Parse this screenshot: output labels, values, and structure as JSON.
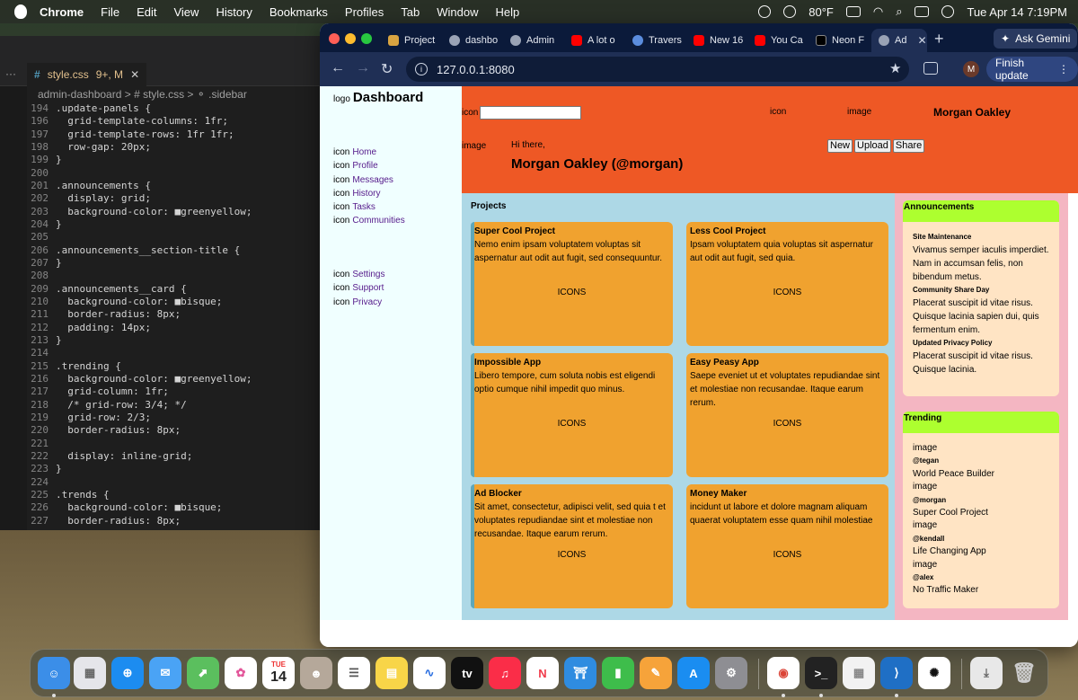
{
  "menubar": {
    "app": "Chrome",
    "menus": [
      "File",
      "Edit",
      "View",
      "History",
      "Bookmarks",
      "Profiles",
      "Tab",
      "Window",
      "Help"
    ],
    "temperature": "80°F",
    "datetime": "Tue Apr 14  7:19PM"
  },
  "editor": {
    "tab_label": "style.css",
    "tab_status": "9+, M",
    "breadcrumb": "admin-dashboard > # style.css > ⚬ .sidebar",
    "lines": [
      {
        "num": "194",
        "code": ".update-panels {"
      },
      {
        "num": "196",
        "code": "  grid-template-columns: 1fr;"
      },
      {
        "num": "197",
        "code": "  grid-template-rows: 1fr 1fr;"
      },
      {
        "num": "198",
        "code": "  row-gap: 20px;"
      },
      {
        "num": "199",
        "code": "}"
      },
      {
        "num": "200",
        "code": ""
      },
      {
        "num": "201",
        "code": ".announcements {"
      },
      {
        "num": "202",
        "code": "  display: grid;"
      },
      {
        "num": "203",
        "code": "  background-color: ■greenyellow;"
      },
      {
        "num": "204",
        "code": "}"
      },
      {
        "num": "205",
        "code": ""
      },
      {
        "num": "206",
        "code": ".announcements__section-title {"
      },
      {
        "num": "207",
        "code": "}"
      },
      {
        "num": "208",
        "code": ""
      },
      {
        "num": "209",
        "code": ".announcements__card {"
      },
      {
        "num": "210",
        "code": "  background-color: ■bisque;"
      },
      {
        "num": "211",
        "code": "  border-radius: 8px;"
      },
      {
        "num": "212",
        "code": "  padding: 14px;"
      },
      {
        "num": "213",
        "code": "}"
      },
      {
        "num": "214",
        "code": ""
      },
      {
        "num": "215",
        "code": ".trending {"
      },
      {
        "num": "216",
        "code": "  background-color: ■greenyellow;"
      },
      {
        "num": "217",
        "code": "  grid-column: 1fr;"
      },
      {
        "num": "218",
        "code": "  /* grid-row: 3/4; */"
      },
      {
        "num": "219",
        "code": "  grid-row: 2/3;"
      },
      {
        "num": "220",
        "code": "  border-radius: 8px;"
      },
      {
        "num": "221",
        "code": ""
      },
      {
        "num": "222",
        "code": "  display: inline-grid;"
      },
      {
        "num": "223",
        "code": "}"
      },
      {
        "num": "224",
        "code": ""
      },
      {
        "num": "225",
        "code": ".trends {"
      },
      {
        "num": "226",
        "code": "  background-color: ■bisque;"
      },
      {
        "num": "227",
        "code": "  border-radius: 8px;"
      }
    ]
  },
  "browser": {
    "tabs": [
      "Project",
      "dashbo",
      "Admin",
      "A lot o",
      "Travers",
      "New 16",
      "You Ca",
      "Neon F",
      "Ad"
    ],
    "url": "127.0.0.1:8080",
    "gemini_label": "Ask Gemini",
    "profile_initial": "M",
    "finish_update_label": "Finish update"
  },
  "page": {
    "sidebar": {
      "logo_text": "logo",
      "title": "Dashboard",
      "icon_text": "icon",
      "nav": [
        "Home",
        "Profile",
        "Messages",
        "History",
        "Tasks",
        "Communities"
      ],
      "nav_bottom": [
        "Settings",
        "Support",
        "Privacy"
      ]
    },
    "header": {
      "icon_text": "icon",
      "image_text": "image",
      "username": "Morgan Oakley",
      "greeting": "Hi there,",
      "full_name": "Morgan Oakley (@morgan)",
      "buttons": [
        "New",
        "Upload",
        "Share"
      ]
    },
    "projects": {
      "title": "Projects",
      "icons_text": "ICONS",
      "cards": [
        {
          "title": "Super Cool Project",
          "body": "Nemo enim ipsam voluptatem voluptas sit aspernatur aut odit aut fugit, sed consequuntur."
        },
        {
          "title": "Less Cool Project",
          "body": "Ipsam voluptatem quia voluptas sit aspernatur aut odit aut fugit, sed quia."
        },
        {
          "title": "Impossible App",
          "body": "Libero tempore, cum soluta nobis est eligendi optio cumque nihil impedit quo minus."
        },
        {
          "title": "Easy Peasy App",
          "body": "Saepe eveniet ut et voluptates repudiandae sint et molestiae non recusandae. Itaque earum rerum."
        },
        {
          "title": "Ad Blocker",
          "body": "Sit amet, consectetur, adipisci velit, sed quia t et voluptates repudiandae sint et molestiae non recusandae. Itaque earum rerum."
        },
        {
          "title": "Money Maker",
          "body": "incidunt ut labore et dolore magnam aliquam quaerat voluptatem esse quam nihil molestiae"
        }
      ]
    },
    "announcements": {
      "title": "Announcements",
      "items": [
        {
          "title": "Site Maintenance",
          "body": "Vivamus semper iaculis imperdiet. Nam in accumsan felis, non bibendum metus."
        },
        {
          "title": "Community Share Day",
          "body": "Placerat suscipit id vitae risus. Quisque lacinia sapien dui, quis fermentum enim."
        },
        {
          "title": "Updated Privacy Policy",
          "body": "Placerat suscipit id vitae risus. Quisque lacinia."
        }
      ]
    },
    "trending": {
      "title": "Trending",
      "image_text": "image",
      "items": [
        {
          "handle": "@tegan",
          "project": "World Peace Builder"
        },
        {
          "handle": "@morgan",
          "project": "Super Cool Project"
        },
        {
          "handle": "@kendall",
          "project": "Life Changing App"
        },
        {
          "handle": "@alex",
          "project": "No Traffic Maker"
        }
      ]
    }
  },
  "dock": {
    "calendar_month": "TUE",
    "calendar_day": "14",
    "tv_label": "tv"
  }
}
